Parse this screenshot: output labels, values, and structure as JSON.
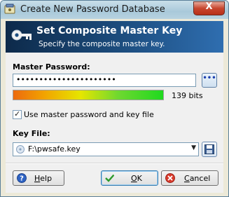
{
  "window": {
    "title": "Create New Password Database",
    "close_label": "X"
  },
  "banner": {
    "title": "Set Composite Master Key",
    "subtitle": "Specify the composite master key."
  },
  "master_password": {
    "label": "Master Password:",
    "value": "••••••••••••••••••••••",
    "toggle_label": "•••",
    "quality_fraction": 1.0,
    "quality_text": "139 bits"
  },
  "use_keyfile": {
    "checked": true,
    "label": "Use master password and key file"
  },
  "key_file": {
    "label": "Key File:",
    "value": "F:\\pwsafe.key"
  },
  "buttons": {
    "help": "Help",
    "ok": "OK",
    "cancel": "Cancel"
  },
  "colors": {
    "banner_dark": "#0d2a4a",
    "banner_light": "#2f6eb0",
    "ok_border": "#3c7fb1"
  }
}
